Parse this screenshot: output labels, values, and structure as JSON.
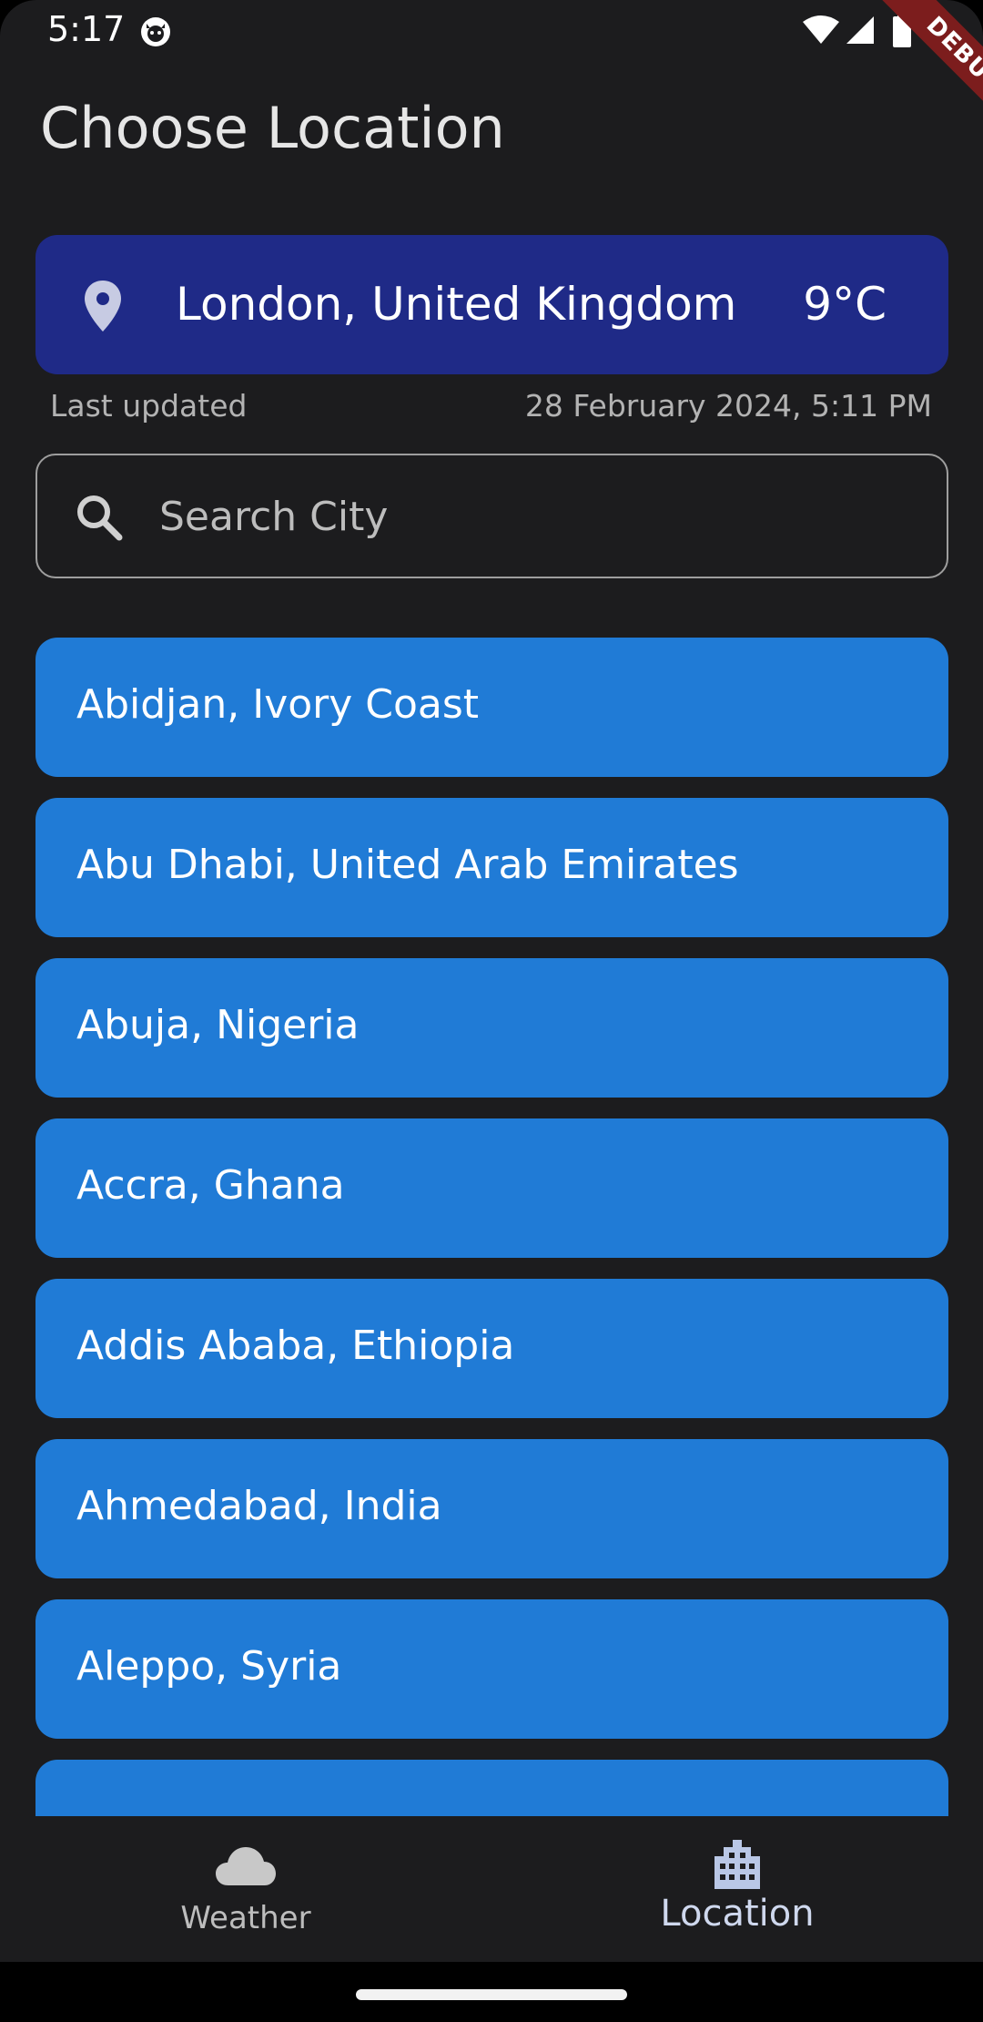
{
  "status_bar": {
    "time": "5:17"
  },
  "debug_banner": "DEBUG",
  "page_title": "Choose Location",
  "current_location": {
    "city": "London, United Kingdom",
    "temperature": "9°C",
    "icon": "location-pin-icon"
  },
  "last_updated": {
    "label": "Last updated",
    "value": "28 February 2024, 5:11 PM"
  },
  "search": {
    "placeholder": "Search City",
    "value": "",
    "icon": "search-icon"
  },
  "cities": [
    "Abidjan, Ivory Coast",
    "Abu Dhabi, United Arab Emirates",
    "Abuja, Nigeria",
    "Accra, Ghana",
    "Addis Ababa, Ethiopia",
    "Ahmedabad, India",
    "Aleppo, Syria",
    ""
  ],
  "bottom_nav": {
    "items": [
      {
        "label": "Weather",
        "icon": "cloud-icon",
        "selected": false
      },
      {
        "label": "Location",
        "icon": "city-buildings-icon",
        "selected": true
      }
    ]
  },
  "colors": {
    "background": "#1c1c1e",
    "current_card": "#1f2a87",
    "city_item": "#207bd6",
    "debug_banner": "#7c1d1d"
  }
}
